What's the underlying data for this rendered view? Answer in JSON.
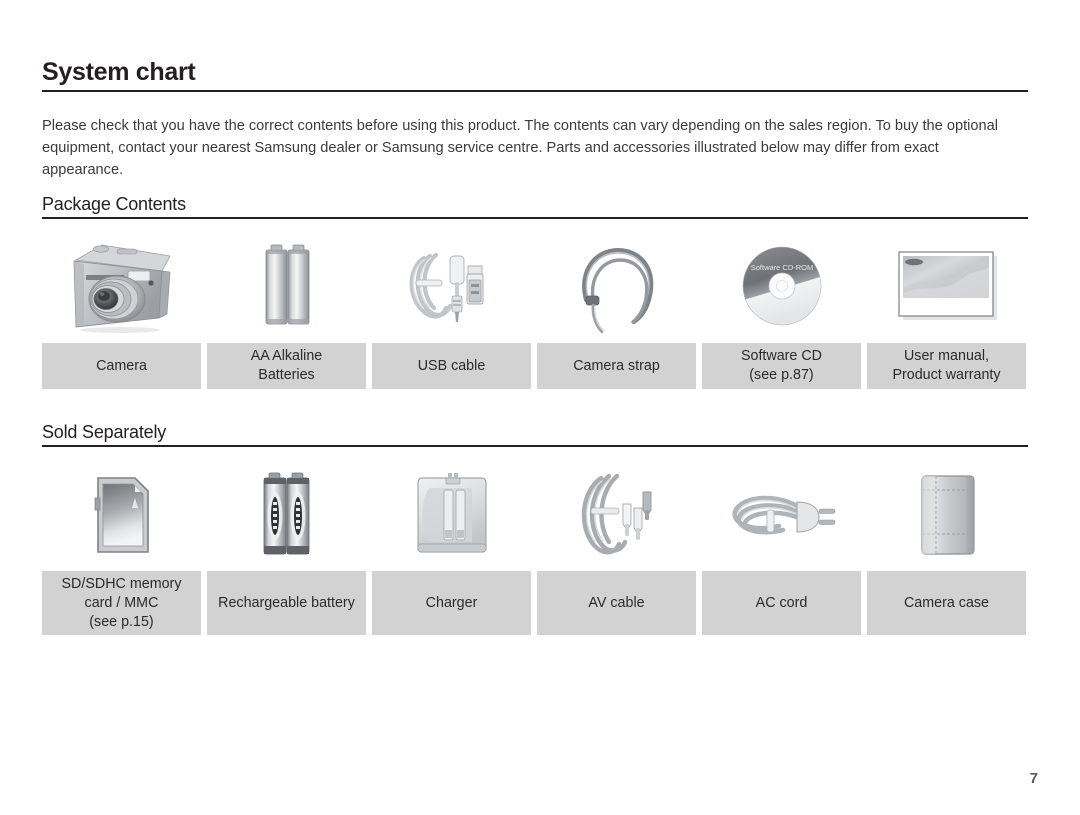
{
  "document": {
    "title": "System chart",
    "intro": "Please check that you have the correct contents before using this product. The contents can vary depending on the sales region. To buy the optional equipment, contact your nearest Samsung dealer or Samsung service centre. Parts and accessories illustrated below may differ from exact appearance.",
    "page_number": "7"
  },
  "sections": [
    {
      "heading": "Package Contents",
      "items": [
        {
          "icon": "camera-icon",
          "label": "Camera"
        },
        {
          "icon": "aa-batteries-icon",
          "label": "AA Alkaline\nBatteries"
        },
        {
          "icon": "usb-cable-icon",
          "label": "USB cable"
        },
        {
          "icon": "camera-strap-icon",
          "label": "Camera strap"
        },
        {
          "icon": "software-cd-icon",
          "label": "Software CD\n(see p.87)",
          "disc_text": "Software CD-ROM"
        },
        {
          "icon": "user-manual-icon",
          "label": "User manual,\nProduct warranty"
        }
      ]
    },
    {
      "heading": "Sold Separately",
      "items": [
        {
          "icon": "sd-card-icon",
          "label": "SD/SDHC memory\ncard / MMC\n(see p.15)"
        },
        {
          "icon": "rechargeable-battery-icon",
          "label": "Rechargeable battery"
        },
        {
          "icon": "charger-icon",
          "label": "Charger"
        },
        {
          "icon": "av-cable-icon",
          "label": "AV cable"
        },
        {
          "icon": "ac-cord-icon",
          "label": "AC cord"
        },
        {
          "icon": "camera-case-icon",
          "label": "Camera case"
        }
      ]
    }
  ],
  "colors": {
    "caption_background": "#d2d2d2",
    "text": "#231f20",
    "body_text": "#3b3b3b",
    "page_number": "#58595b",
    "product_grey_light": "#e8e9ea",
    "product_grey_mid": "#b9babc",
    "product_grey_dark": "#76787b"
  }
}
